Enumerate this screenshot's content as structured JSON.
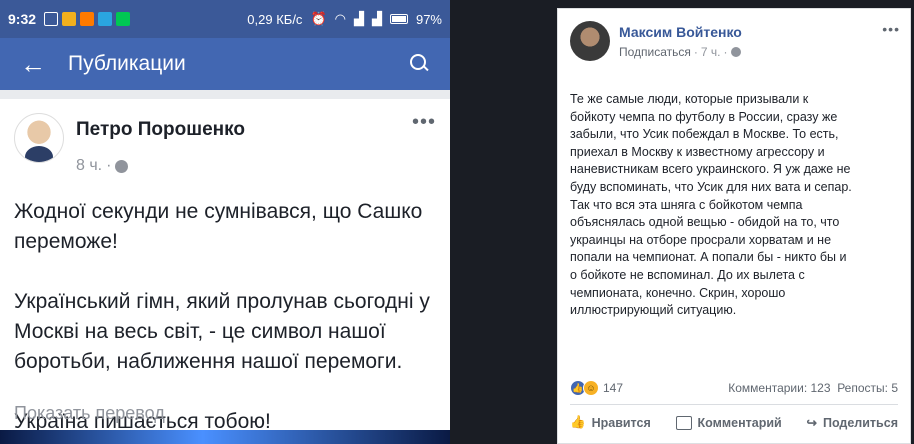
{
  "phone": {
    "status": {
      "time": "9:32",
      "speed": "0,29 КБ/с",
      "battery": "97%"
    },
    "appbar": {
      "back_icon": "arrow-left-icon",
      "title": "Публикации",
      "search_icon": "search-icon"
    },
    "post": {
      "author": "Петро Порошенко",
      "time": "8 ч.",
      "more": "•••",
      "paragraphs": [
        "Жодної секунди не сумнівався, що Сашко переможе!",
        "Український гімн, який пролунав сьогодні у Москві на весь світ, - це символ нашої боротьби, наближення нашої перемоги.",
        "Україна пишається тобою!"
      ],
      "translate": "Показать перевод"
    }
  },
  "desktop": {
    "post": {
      "author": "Максим Войтенко",
      "follow": "Подписаться",
      "time": "7 ч.",
      "text": "Те же самые люди, которые призывали к бойкоту чемпа по футболу в России, сразу же забыли, что Усик побеждал в Москве. То есть, приехал в Москву к известному агрессору и наневистникам всего украинского. Я уж даже не буду вспоминать, что Усик для них вата и сепар. Так что вся эта шняга с бойкотом чемпа объяснялась одной вещью - обидой на то, что украинцы на отборе просрали хорватам и не попали на чемпионат. А попали бы - никто бы и о бойкоте не вспоминал. До их вылета с чемпионата, конечно. Скрин, хорошо иллюстрирующий ситуацию.",
      "reactions_count": "147",
      "comments": "Комментарии: 123",
      "shares": "Репосты: 5",
      "actions": {
        "like": "Нравится",
        "comment": "Комментарий",
        "share": "Поделиться"
      }
    }
  }
}
